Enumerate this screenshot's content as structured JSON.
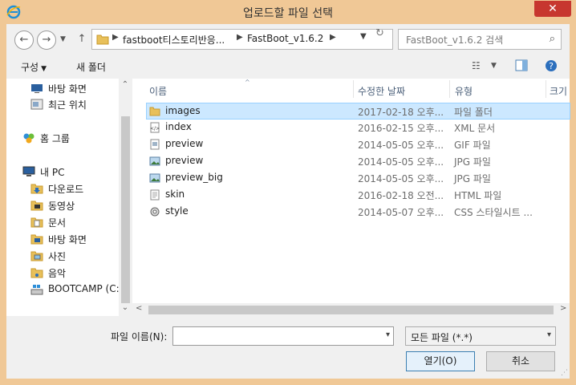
{
  "window": {
    "title": "업로드할 파일 선택",
    "close_label": "✕"
  },
  "nav": {
    "back_icon": "←",
    "forward_icon": "→",
    "up_icon": "↑",
    "breadcrumbs": [
      "fastboot티스토리반응...",
      "FastBoot_v1.6.2"
    ],
    "search_placeholder": "FastBoot_v1.6.2 검색"
  },
  "toolbar": {
    "organize": "구성",
    "new_folder": "새 폴더"
  },
  "sidebar": {
    "items": [
      {
        "label": "바탕 화면",
        "icon": "desktop-icon"
      },
      {
        "label": "최근 위치",
        "icon": "recent-places-icon"
      },
      {
        "label": "홈 그룹",
        "icon": "homegroup-icon"
      },
      {
        "label": "내 PC",
        "icon": "computer-icon"
      },
      {
        "label": "다운로드",
        "icon": "downloads-folder-icon"
      },
      {
        "label": "동영상",
        "icon": "videos-folder-icon"
      },
      {
        "label": "문서",
        "icon": "documents-folder-icon"
      },
      {
        "label": "바탕 화면",
        "icon": "desktop-folder-icon"
      },
      {
        "label": "사진",
        "icon": "pictures-folder-icon"
      },
      {
        "label": "음악",
        "icon": "music-folder-icon"
      },
      {
        "label": "BOOTCAMP (C:)",
        "icon": "drive-icon"
      }
    ]
  },
  "columns": {
    "name": "이름",
    "modified": "수정한 날짜",
    "type": "유형",
    "size": "크기"
  },
  "files": [
    {
      "name": "images",
      "modified": "2017-02-18 오후...",
      "type": "파일 폴더",
      "icon": "folder-icon"
    },
    {
      "name": "index",
      "modified": "2016-02-15 오후...",
      "type": "XML 문서",
      "icon": "xml-file-icon"
    },
    {
      "name": "preview",
      "modified": "2014-05-05 오후...",
      "type": "GIF 파일",
      "icon": "gif-file-icon"
    },
    {
      "name": "preview",
      "modified": "2014-05-05 오후...",
      "type": "JPG 파일",
      "icon": "image-file-icon"
    },
    {
      "name": "preview_big",
      "modified": "2014-05-05 오후...",
      "type": "JPG 파일",
      "icon": "image-file-icon"
    },
    {
      "name": "skin",
      "modified": "2016-02-18 오전...",
      "type": "HTML 파일",
      "icon": "html-file-icon"
    },
    {
      "name": "style",
      "modified": "2014-05-07 오후...",
      "type": "CSS 스타일시트 ...",
      "icon": "css-file-icon"
    }
  ],
  "footer": {
    "filename_label": "파일 이름(N):",
    "filename_value": "",
    "filetype_value": "모든 파일 (*.*)",
    "open_button": "열기(O)",
    "cancel_button": "취소"
  },
  "colors": {
    "titlebar": "#f0c896",
    "close": "#c7372f",
    "selection": "#cce8ff"
  }
}
